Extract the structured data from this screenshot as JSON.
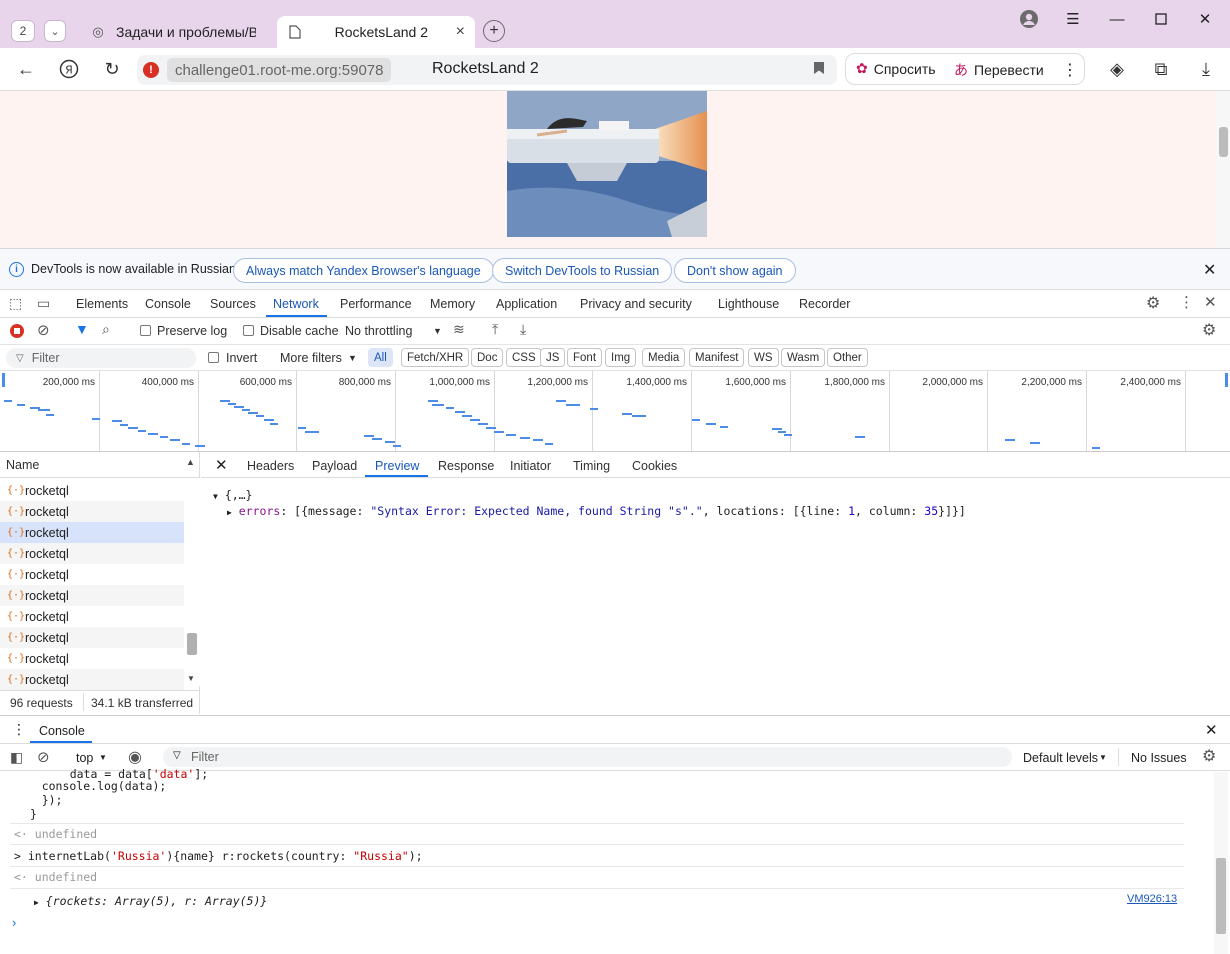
{
  "browser": {
    "tab_count": "2",
    "tabs": [
      {
        "title": "Задачи и проблемы/Веб",
        "active": false
      },
      {
        "title": "RocketsLand 2",
        "active": true
      }
    ],
    "url_host": "challenge01.root-me.org:59078",
    "page_title": "RocketsLand 2",
    "ask_label": "Спросить",
    "translate_label": "Перевести"
  },
  "infobar": {
    "message": "DevTools is now available in Russian!",
    "btn_match": "Always match Yandex Browser's language",
    "btn_switch": "Switch DevTools to Russian",
    "btn_dont": "Don't show again"
  },
  "devtools": {
    "tabs": [
      "Elements",
      "Console",
      "Sources",
      "Network",
      "Performance",
      "Memory",
      "Application",
      "Privacy and security",
      "Lighthouse",
      "Recorder"
    ],
    "active_tab": "Network"
  },
  "network_toolbar": {
    "preserve_log": "Preserve log",
    "disable_cache": "Disable cache",
    "throttling": "No throttling"
  },
  "filter_bar": {
    "placeholder": "Filter",
    "invert": "Invert",
    "more_filters": "More filters",
    "chips": [
      "All",
      "Fetch/XHR",
      "Doc",
      "CSS",
      "JS",
      "Font",
      "Img",
      "Media",
      "Manifest",
      "WS",
      "Wasm",
      "Other"
    ],
    "active_chip": "All"
  },
  "overview": {
    "ticks": [
      "200,000 ms",
      "400,000 ms",
      "600,000 ms",
      "800,000 ms",
      "1,000,000 ms",
      "1,200,000 ms",
      "1,400,000 ms",
      "1,600,000 ms",
      "1,800,000 ms",
      "2,000,000 ms",
      "2,200,000 ms",
      "2,400,000 ms"
    ]
  },
  "requests": {
    "header": "Name",
    "items": [
      "rocketql",
      "rocketql",
      "rocketql",
      "rocketql",
      "rocketql",
      "rocketql",
      "rocketql",
      "rocketql",
      "rocketql",
      "rocketql"
    ],
    "selected_index": 2,
    "count": "96 requests",
    "transferred": "34.1 kB transferred"
  },
  "detail": {
    "tabs": [
      "Headers",
      "Payload",
      "Preview",
      "Response",
      "Initiator",
      "Timing",
      "Cookies"
    ],
    "active_tab": "Preview",
    "root": "{,…}",
    "errors_key": "errors",
    "errors_open": "[{message: ",
    "errors_msg": "\"Syntax Error: Expected Name, found String \"s\".\"",
    "errors_loc": ", locations: [{line: ",
    "line": "1",
    "col_label": ", column: ",
    "column": "35",
    "errors_close": "}]}]"
  },
  "console": {
    "tab": "Console",
    "context": "top",
    "filter_placeholder": "Filter",
    "levels": "Default levels",
    "issues": "No Issues",
    "lines": {
      "code1a": "    data = data[",
      "code1b": "'data'",
      "code1c": "];",
      "code2": "    console.log(data);",
      "code3": "    });",
      "code4": "}",
      "undef1": "undefined",
      "input_a": "internetLab(",
      "input_b": "'Russia'",
      "input_c": "){name} r:rockets(country: ",
      "input_d": "\"Russia\"",
      "input_e": ");",
      "undef2": "undefined",
      "obj": "{rockets: Array(5), r: Array(5)}",
      "source": "VM926:13"
    }
  }
}
